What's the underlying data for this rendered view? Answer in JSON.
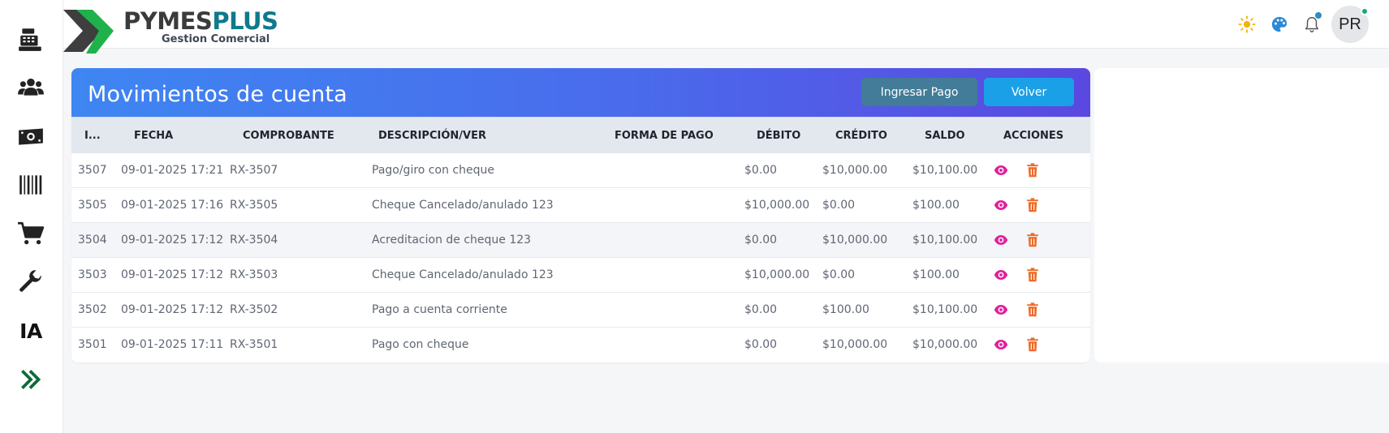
{
  "brand": {
    "part1": "PYMES",
    "part2": "PLUS",
    "subtitle": "Gestion Comercial"
  },
  "sidebar": {
    "items": [
      {
        "icon": "cash-register-icon"
      },
      {
        "icon": "users-icon"
      },
      {
        "icon": "money-icon"
      },
      {
        "icon": "barcode-icon"
      },
      {
        "icon": "cart-icon"
      },
      {
        "icon": "wrench-icon"
      },
      {
        "icon": "ia-icon",
        "label": "IA"
      },
      {
        "icon": "double-chevron-right-icon"
      }
    ]
  },
  "header": {
    "avatar_initials": "PR",
    "icons": [
      "sun-icon",
      "palette-icon",
      "bell-icon"
    ]
  },
  "panel": {
    "title": "Movimientos de cuenta",
    "buttons": {
      "pago": "Ingresar Pago",
      "volver": "Volver"
    }
  },
  "table": {
    "columns": [
      "I...",
      "FECHA",
      "COMPROBANTE",
      "DESCRIPCIÓN/VER",
      "FORMA DE PAGO",
      "DÉBITO",
      "CRÉDITO",
      "SALDO",
      "ACCIONES"
    ],
    "rows": [
      {
        "id": "3507",
        "fecha": "09-01-2025 17:21",
        "comprobante": "RX-3507",
        "descripcion": "Pago/giro con cheque",
        "forma": "",
        "debito": "$0.00",
        "credito": "$10,000.00",
        "saldo": "$10,100.00"
      },
      {
        "id": "3505",
        "fecha": "09-01-2025 17:16",
        "comprobante": "RX-3505",
        "descripcion": "Cheque Cancelado/anulado 123",
        "forma": "",
        "debito": "$10,000.00",
        "credito": "$0.00",
        "saldo": "$100.00"
      },
      {
        "id": "3504",
        "fecha": "09-01-2025 17:12",
        "comprobante": "RX-3504",
        "descripcion": "Acreditacion de cheque 123",
        "forma": "",
        "debito": "$0.00",
        "credito": "$10,000.00",
        "saldo": "$10,100.00"
      },
      {
        "id": "3503",
        "fecha": "09-01-2025 17:12",
        "comprobante": "RX-3503",
        "descripcion": "Cheque Cancelado/anulado 123",
        "forma": "",
        "debito": "$10,000.00",
        "credito": "$0.00",
        "saldo": "$100.00"
      },
      {
        "id": "3502",
        "fecha": "09-01-2025 17:12",
        "comprobante": "RX-3502",
        "descripcion": "Pago a cuenta corriente",
        "forma": "",
        "debito": "$0.00",
        "credito": "$100.00",
        "saldo": "$10,100.00"
      },
      {
        "id": "3501",
        "fecha": "09-01-2025 17:11",
        "comprobante": "RX-3501",
        "descripcion": "Pago con cheque",
        "forma": "",
        "debito": "$0.00",
        "credito": "$10,000.00",
        "saldo": "$10,000.00"
      }
    ]
  },
  "colors": {
    "header_gradient_start": "#3e86f2",
    "header_gradient_end": "#5a48e0",
    "btn_pago": "#427c98",
    "btn_volver": "#1aa0e6",
    "view_icon": "#e0209a",
    "delete_icon": "#f06a25"
  }
}
